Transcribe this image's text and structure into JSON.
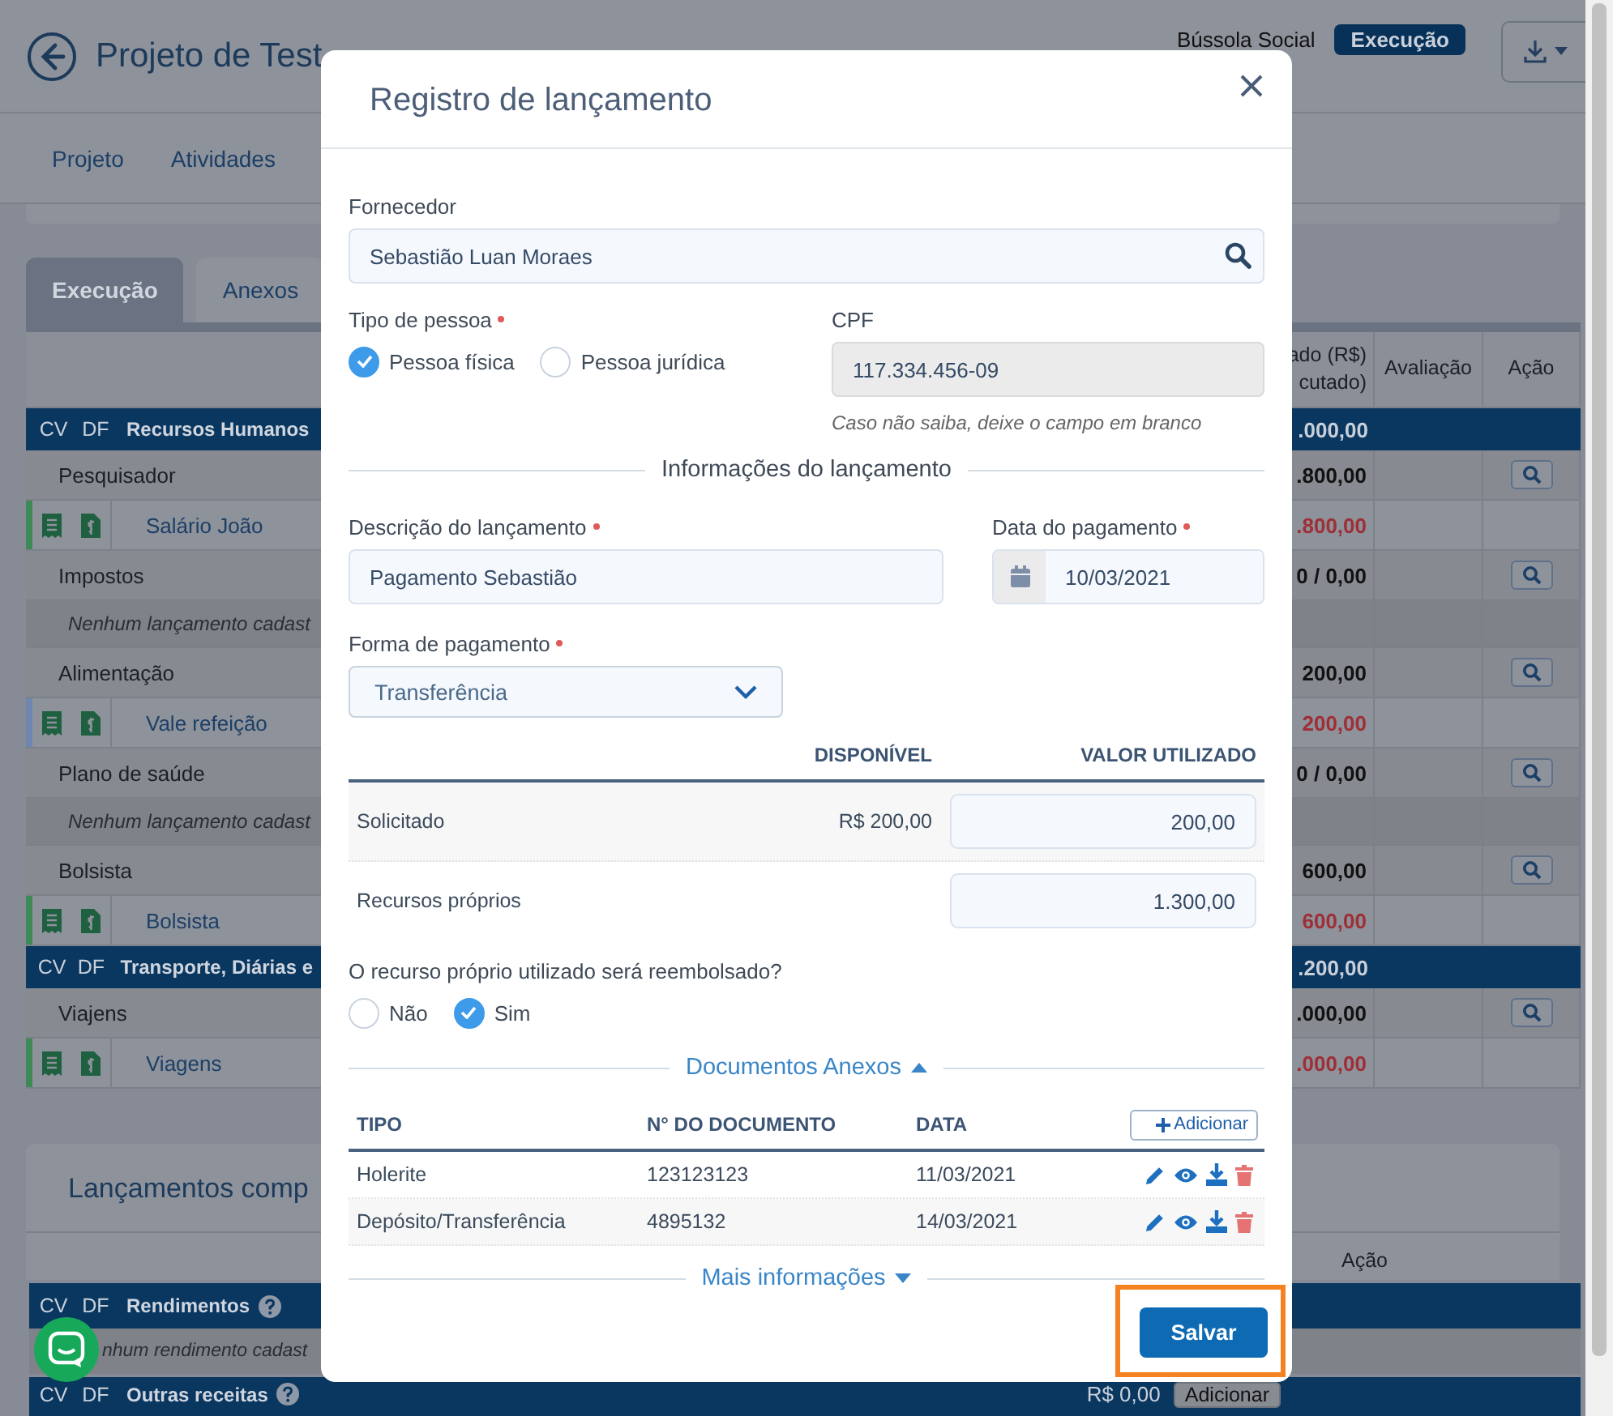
{
  "page": {
    "title": "Projeto de Test",
    "program": "Bússola Social",
    "status": "Execução",
    "nav": [
      {
        "label": "Projeto"
      },
      {
        "label": "Atividades"
      }
    ],
    "tabs": [
      {
        "label": "Execução",
        "selected": true
      },
      {
        "label": "Anexos",
        "selected": false
      }
    ],
    "table": {
      "columns": [
        {
          "lines": [
            "ado (R$)",
            "cutado)"
          ]
        },
        {
          "lines": [
            "Avaliação"
          ]
        },
        {
          "lines": [
            "Ação"
          ]
        }
      ],
      "rows": [
        {
          "kind": "group",
          "cv": "CV",
          "df": "DF",
          "label": "Recursos Humanos",
          "value": ".000,00"
        },
        {
          "kind": "category",
          "label": "Pesquisador",
          "value": ".800,00"
        },
        {
          "kind": "item",
          "label": "Salário João",
          "value": ".800,00",
          "color": "#3e8a57"
        },
        {
          "kind": "category",
          "label": "Impostos",
          "value": "0 / **0,00**"
        },
        {
          "kind": "empty",
          "label": "Nenhum lançamento cadast"
        },
        {
          "kind": "category",
          "label": "Alimentação",
          "value": "200,00"
        },
        {
          "kind": "item",
          "label": "Vale refeição",
          "value": "200,00",
          "color": "#6f86b0"
        },
        {
          "kind": "category",
          "label": "Plano de saúde",
          "value": "0 / **0,00**"
        },
        {
          "kind": "empty",
          "label": "Nenhum lançamento cadast"
        },
        {
          "kind": "category",
          "label": "Bolsista",
          "value": "600,00"
        },
        {
          "kind": "item",
          "label": "Bolsista",
          "value": "600,00",
          "color": "#3e8a57"
        },
        {
          "kind": "group",
          "cv": "CV",
          "df": "DF",
          "label": "Transporte, Diárias e",
          "value": ".200,00"
        },
        {
          "kind": "category",
          "label": "Viajens",
          "value": ".000,00"
        },
        {
          "kind": "item",
          "label": "Viagens",
          "value": ".000,00",
          "color": "#3e8a57"
        }
      ]
    },
    "section": {
      "title": "Lançamentos comp",
      "column": "Ação",
      "rows": [
        {
          "kind": "group",
          "cv": "CV",
          "df": "DF",
          "label": "Rendimentos",
          "help": true
        },
        {
          "kind": "empty",
          "label": "nhum rendimento cadast"
        },
        {
          "kind": "group",
          "cv": "CV",
          "df": "DF",
          "label": "Outras receitas",
          "help": true,
          "value": "R$ 0,00",
          "button": "Adicionar"
        }
      ]
    }
  },
  "modal": {
    "title": "Registro de lançamento",
    "supplier": {
      "label": "Fornecedor",
      "value": "Sebastião Luan Moraes"
    },
    "person_type": {
      "label": "Tipo de pessoa",
      "required": true,
      "options": [
        {
          "label": "Pessoa física",
          "selected": true
        },
        {
          "label": "Pessoa jurídica",
          "selected": false
        }
      ]
    },
    "cpf": {
      "label": "CPF",
      "value": "117.334.456-09",
      "disabled": true,
      "hint": "Caso não saiba, deixe o campo em branco"
    },
    "section_title": "Informações do lançamento",
    "description": {
      "label": "Descrição do lançamento",
      "required": true,
      "value": "Pagamento Sebastião"
    },
    "payment_date": {
      "label": "Data do pagamento",
      "required": true,
      "value": "10/03/2021"
    },
    "payment_method": {
      "label": "Forma de pagamento",
      "required": true,
      "value": "Transferência"
    },
    "resources": {
      "columns": [
        "DISPONÍVEL",
        "VALOR UTILIZADO"
      ],
      "rows": [
        {
          "label": "Solicitado",
          "available": "R$ 200,00",
          "value": "200,00"
        },
        {
          "label": "Recursos próprios",
          "value": "1.300,00"
        }
      ]
    },
    "reimburse": {
      "label": "O recurso próprio utilizado será reembolsado?",
      "options": [
        {
          "label": "Não",
          "selected": false
        },
        {
          "label": "Sim",
          "selected": true
        }
      ]
    },
    "documents": {
      "title": "Documentos Anexos",
      "expanded": true,
      "columns": [
        "TIPO",
        "N° DO DOCUMENTO",
        "DATA"
      ],
      "add_label": "Adicionar",
      "rows": [
        {
          "type": "Holerite",
          "number": "123123123",
          "date": "11/03/2021"
        },
        {
          "type": "Depósito/Transferência",
          "number": "4895132",
          "date": "14/03/2021"
        }
      ]
    },
    "more": {
      "title": "Mais informações",
      "expanded": false
    },
    "save_label": "Salvar",
    "save_highlight": true
  }
}
